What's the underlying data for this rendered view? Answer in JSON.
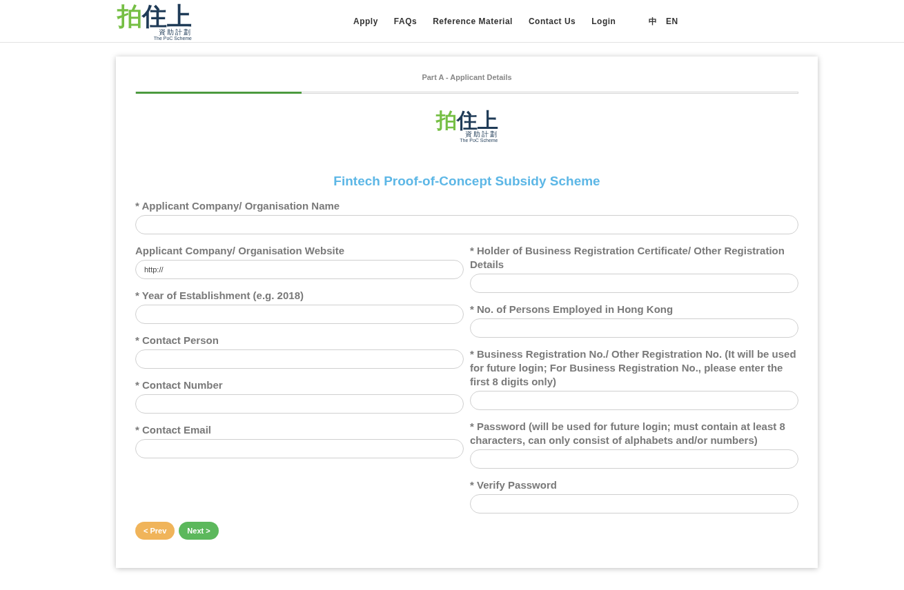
{
  "header": {
    "logo": {
      "parts": [
        {
          "text": "拍",
          "color": "#76bf45"
        },
        {
          "text": "住上",
          "color": "#1f3b57"
        }
      ],
      "subtitle": "資助計劃",
      "caption": "The PoC Scheme"
    },
    "nav": [
      "Apply",
      "FAQs",
      "Reference Material",
      "Contact Us",
      "Login"
    ],
    "languages": [
      "中",
      "EN"
    ]
  },
  "card": {
    "step": {
      "title": "Part A - Applicant Details",
      "level": 0.25
    },
    "logo": {
      "parts": [
        {
          "text": "拍",
          "color": "#76bf45"
        },
        {
          "text": "住上",
          "color": "#1f3b57"
        }
      ],
      "subtitle": "資助計劃",
      "caption": "The PoC Scheme"
    },
    "form_title": "Fintech Proof-of-Concept Subsidy Scheme",
    "full_fields": [
      {
        "label": "* Applicant Company/ Organisation Name"
      }
    ],
    "left_fields": [
      {
        "label": "Applicant Company/ Organisation Website",
        "value": "http://"
      },
      {
        "label": "* Year of Establishment (e.g. 2018)"
      },
      {
        "label": "* Contact Person"
      },
      {
        "label": "* Contact Number"
      },
      {
        "label": "* Contact Email"
      }
    ],
    "right_fields": [
      {
        "label": "* Holder of Business Registration Certificate/ Other Registration Details"
      },
      {
        "label": "* No. of Persons Employed in Hong Kong"
      },
      {
        "label": "* Business Registration No./ Other Registration No. (It will be used for future login; For Business Registration No., please enter the first 8 digits only)"
      },
      {
        "label": "* Password (will be used for future login; must contain at least 8 characters, can only consist of alphabets and/or numbers)"
      },
      {
        "label": "* Verify Password"
      }
    ],
    "buttons": [
      {
        "label": "< Prev",
        "kind": "prev"
      },
      {
        "label": "Next >",
        "kind": "next"
      }
    ]
  }
}
